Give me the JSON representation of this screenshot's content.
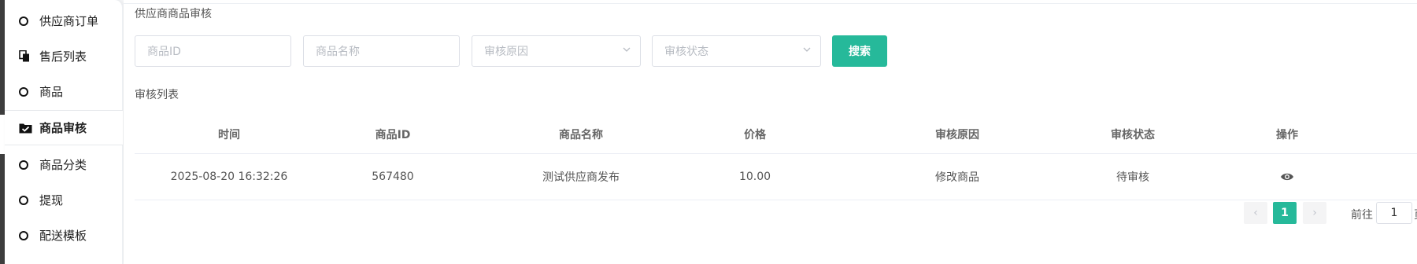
{
  "sidebar": {
    "items": [
      {
        "label": "供应商订单",
        "icon": "circle-icon",
        "active": false
      },
      {
        "label": "售后列表",
        "icon": "copy-icon",
        "active": false
      },
      {
        "label": "商品",
        "icon": "circle-icon",
        "active": false
      },
      {
        "label": "商品审核",
        "icon": "folder-check-icon",
        "active": true
      },
      {
        "label": "商品分类",
        "icon": "circle-icon",
        "active": false
      },
      {
        "label": "提现",
        "icon": "circle-icon",
        "active": false
      },
      {
        "label": "配送模板",
        "icon": "circle-icon",
        "active": false
      }
    ]
  },
  "page": {
    "title": "供应商商品审核",
    "list_title": "审核列表"
  },
  "filters": {
    "product_id_placeholder": "商品ID",
    "product_name_placeholder": "商品名称",
    "reason_placeholder": "审核原因",
    "status_placeholder": "审核状态",
    "search_label": "搜索"
  },
  "table": {
    "headers": [
      "时间",
      "商品ID",
      "商品名称",
      "价格",
      "审核原因",
      "审核状态",
      "操作"
    ],
    "rows": [
      {
        "time": "2025-08-20 16:32:26",
        "product_id": "567480",
        "product_name": "测试供应商发布",
        "price": "10.00",
        "reason": "修改商品",
        "status": "待审核",
        "action_icon": "eye-icon"
      }
    ]
  },
  "pagination": {
    "prev": "‹",
    "current": "1",
    "next": "›",
    "goto_label": "前往",
    "goto_value": "1",
    "goto_suffix": "页"
  },
  "colors": {
    "accent": "#26b99a",
    "sidebar_dark": "#3d3d3d"
  }
}
